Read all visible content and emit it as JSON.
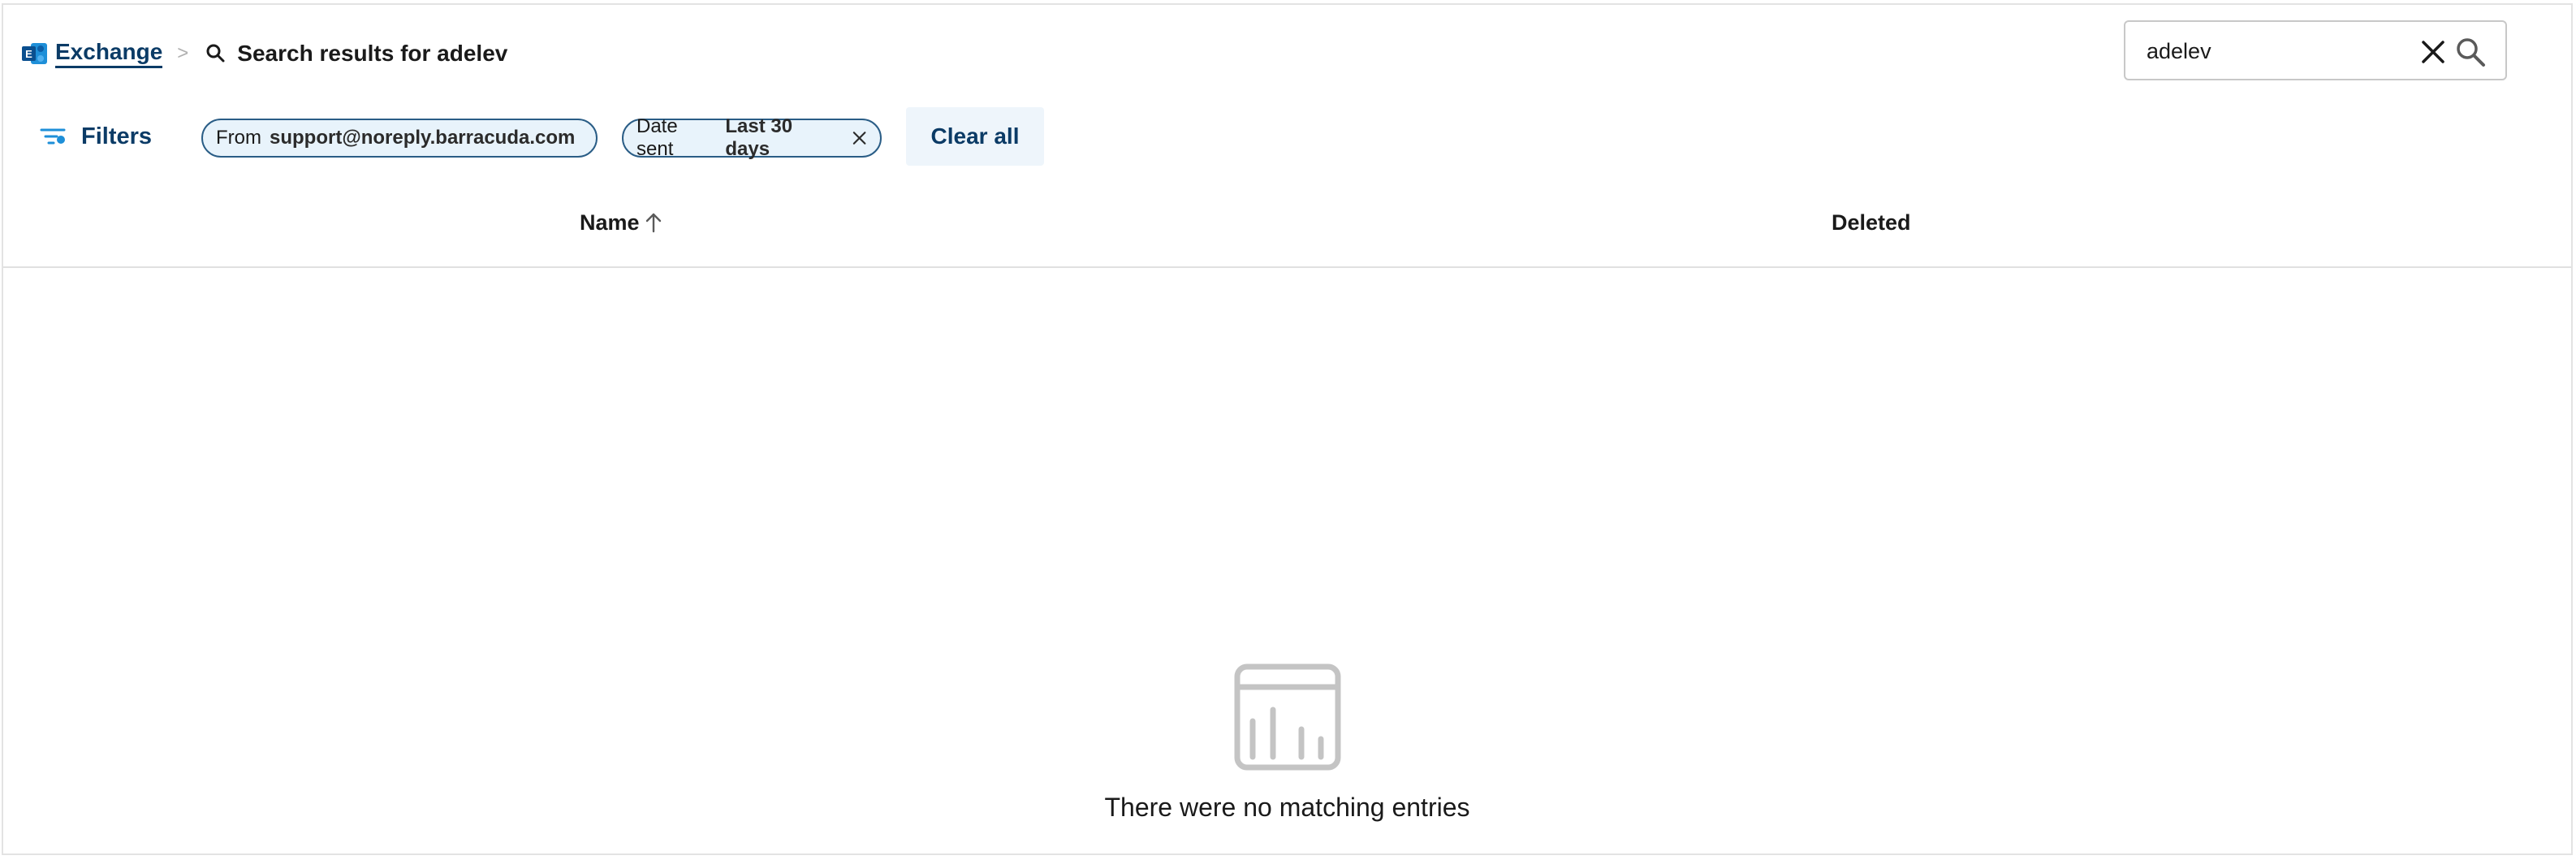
{
  "breadcrumb": {
    "root_label": "Exchange",
    "separator": ">",
    "current_label": "Search results for adelev"
  },
  "search": {
    "value": "adelev",
    "placeholder": ""
  },
  "filters": {
    "button_label": "Filters",
    "chips": [
      {
        "key": "From",
        "value": "support@noreply.barracuda.com"
      },
      {
        "key": "Date sent",
        "value": "Last 30 days"
      }
    ],
    "clear_all_label": "Clear all"
  },
  "table": {
    "columns": [
      {
        "label": "Name",
        "sort": "ascending"
      },
      {
        "label": "Deleted"
      }
    ],
    "rows": []
  },
  "empty_state": {
    "message": "There were no matching entries",
    "icon": "empty-table-icon"
  },
  "colors": {
    "accent": "#0b3b66",
    "chip_bg": "#e8f3fb",
    "chip_border": "#2a5d86",
    "icon_blue": "#1e8fd8",
    "empty_icon": "#c4c4c4"
  }
}
